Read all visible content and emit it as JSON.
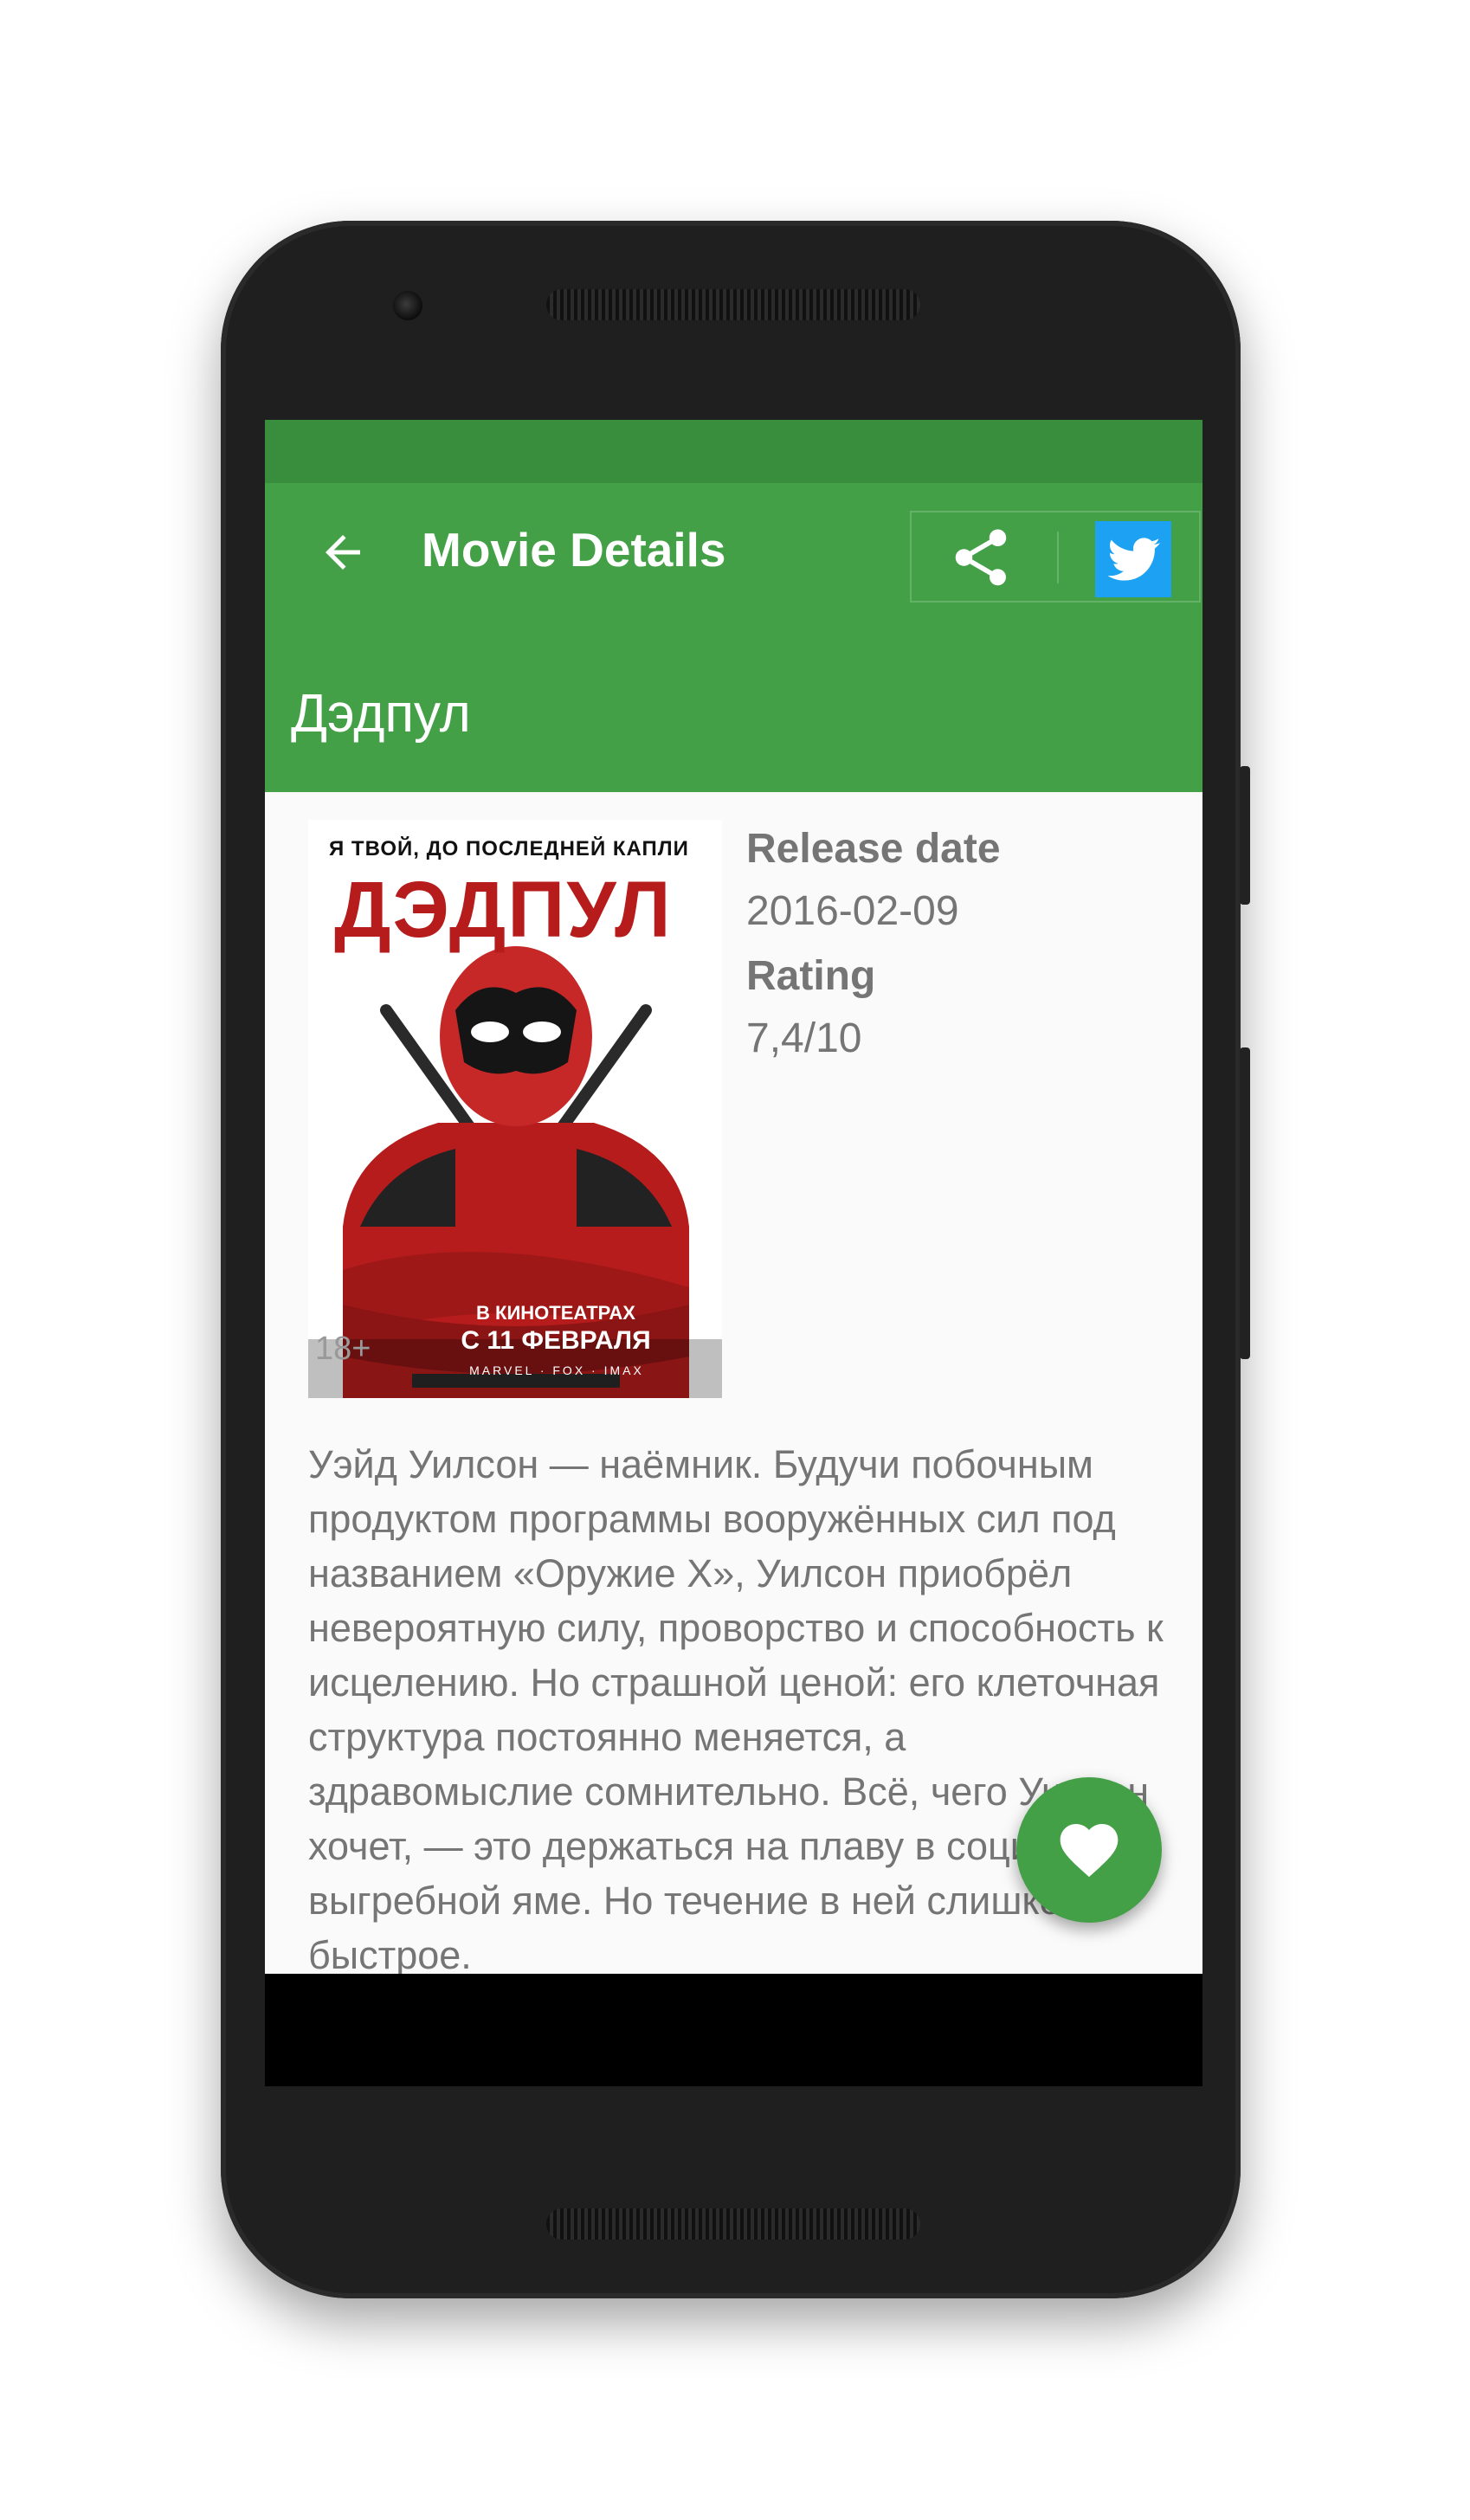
{
  "app_bar": {
    "title": "Movie Details",
    "back_icon": "arrow-back-icon",
    "share_icon": "share-icon",
    "twitter_icon": "twitter-icon"
  },
  "movie": {
    "title": "Дэдпул",
    "release_date_label": "Release date",
    "release_date": "2016-02-09",
    "rating_label": "Rating",
    "rating": "7,4/10",
    "overview": "Уэйд Уилсон — наёмник. Будучи побочным продуктом программы вооружённых сил под названием «Оружие X», Уилсон приобрёл невероятную силу, проворство и способность к исцелению. Но страшной ценой: его клеточная структура постоянно меняется, а здравомыслие сомнительно. Всё, чего Уилсон хочет, — это держаться на плаву в социальной выгребной яме. Но течение в ней слишком быстрое.",
    "poster": {
      "tagline": "Я ТВОЙ, ДО ПОСЛЕДНЕЙ КАПЛИ",
      "name": "ДЭДПУЛ",
      "age_rating": "18+",
      "release_line1": "В КИНОТЕАТРАХ",
      "release_line2": "С 11 ФЕВРАЛЯ",
      "logos": "MARVEL · FOX · IMAX"
    }
  },
  "fab": {
    "icon": "heart-icon"
  },
  "colors": {
    "primary": "#43a047",
    "primary_dark": "#388e3c",
    "twitter": "#1da1f2",
    "text_secondary": "#757575"
  }
}
